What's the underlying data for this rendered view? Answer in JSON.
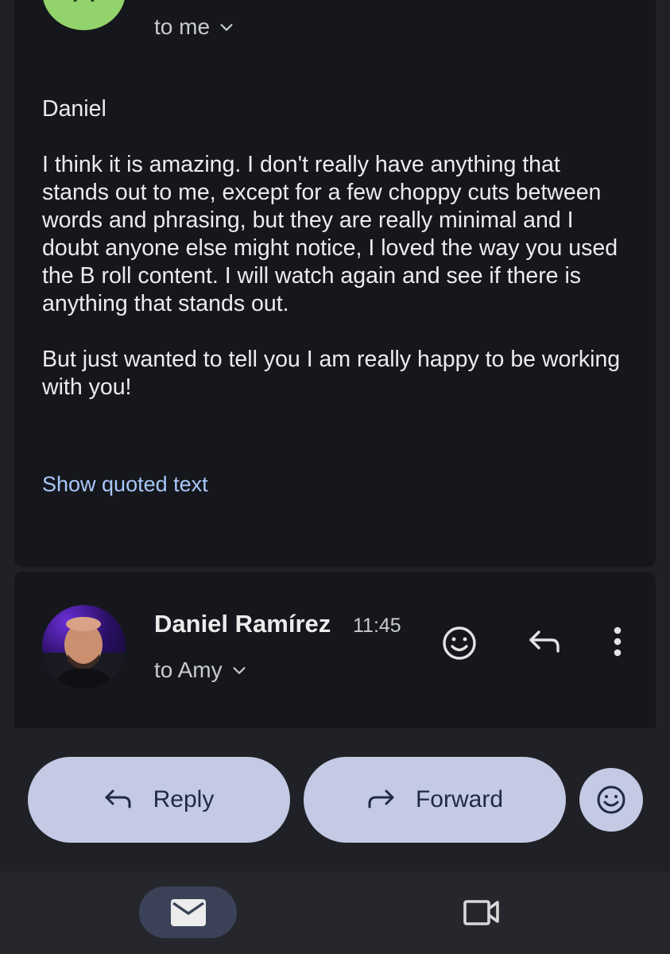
{
  "message1": {
    "avatar_letter": "A",
    "recipient": "to me",
    "body": "Daniel\n\nI think it is amazing.  I don't really have anything that stands out to me, except for a few choppy cuts between words and phrasing, but they are really minimal and I doubt anyone else might notice,  I loved the way you used the B roll content.  I will watch again and see if there is anything that stands out.\n\nBut just wanted to tell you I am really happy to be working with you!",
    "show_quoted": "Show quoted text"
  },
  "message2": {
    "sender": "Daniel Ramírez",
    "time": "11:45",
    "recipient": "to Amy"
  },
  "actions": {
    "reply": "Reply",
    "forward": "Forward"
  },
  "icons": [
    "emoji-react-icon",
    "reply-icon",
    "more-vert-icon",
    "chevron-down-icon",
    "forward-icon",
    "mail-icon",
    "video-icon"
  ],
  "colors": {
    "background": "#1f2126",
    "card": "#15171c",
    "link": "#a8c7fa",
    "button": "#c4c9e4",
    "avatar": "#93d36b",
    "nav_active": "#3b4258"
  }
}
